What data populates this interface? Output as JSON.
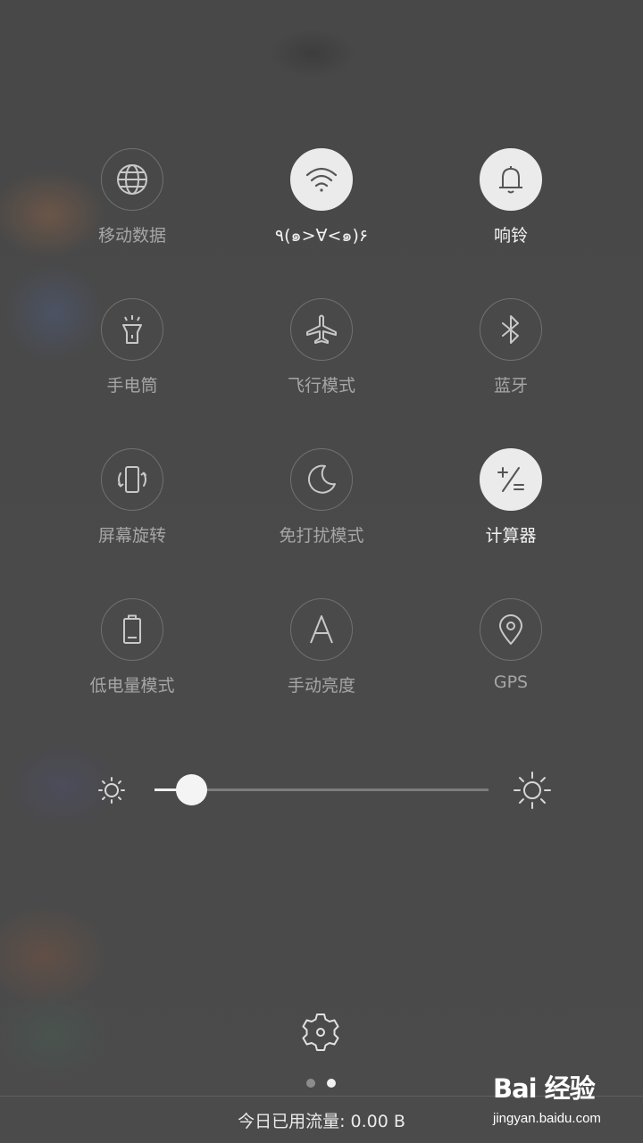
{
  "toggles": [
    {
      "label": "移动数据",
      "icon": "globe-icon",
      "active": false
    },
    {
      "label": "٩(๑>∀<๑)۶",
      "icon": "wifi-icon",
      "active": true
    },
    {
      "label": "响铃",
      "icon": "bell-icon",
      "active": true
    },
    {
      "label": "手电筒",
      "icon": "flashlight-icon",
      "active": false
    },
    {
      "label": "飞行模式",
      "icon": "airplane-icon",
      "active": false
    },
    {
      "label": "蓝牙",
      "icon": "bluetooth-icon",
      "active": false
    },
    {
      "label": "屏幕旋转",
      "icon": "rotate-screen-icon",
      "active": false
    },
    {
      "label": "免打扰模式",
      "icon": "moon-icon",
      "active": false
    },
    {
      "label": "计算器",
      "icon": "calculator-icon",
      "active": true
    },
    {
      "label": "低电量模式",
      "icon": "battery-icon",
      "active": false
    },
    {
      "label": "手动亮度",
      "icon": "letter-a-icon",
      "active": false
    },
    {
      "label": "GPS",
      "icon": "location-pin-icon",
      "active": false
    }
  ],
  "brightness": {
    "level": 0.11
  },
  "pager": {
    "count": 2,
    "current": 2
  },
  "footer": {
    "data_usage": "今日已用流量: 0.00 B"
  },
  "watermark": {
    "logo": "Bai 经验",
    "url": "jingyan.baidu.com"
  },
  "colors": {
    "active_circle": "#ebebeb",
    "inactive_label": "#a6a6a6",
    "active_label": "#f2f2f2"
  }
}
